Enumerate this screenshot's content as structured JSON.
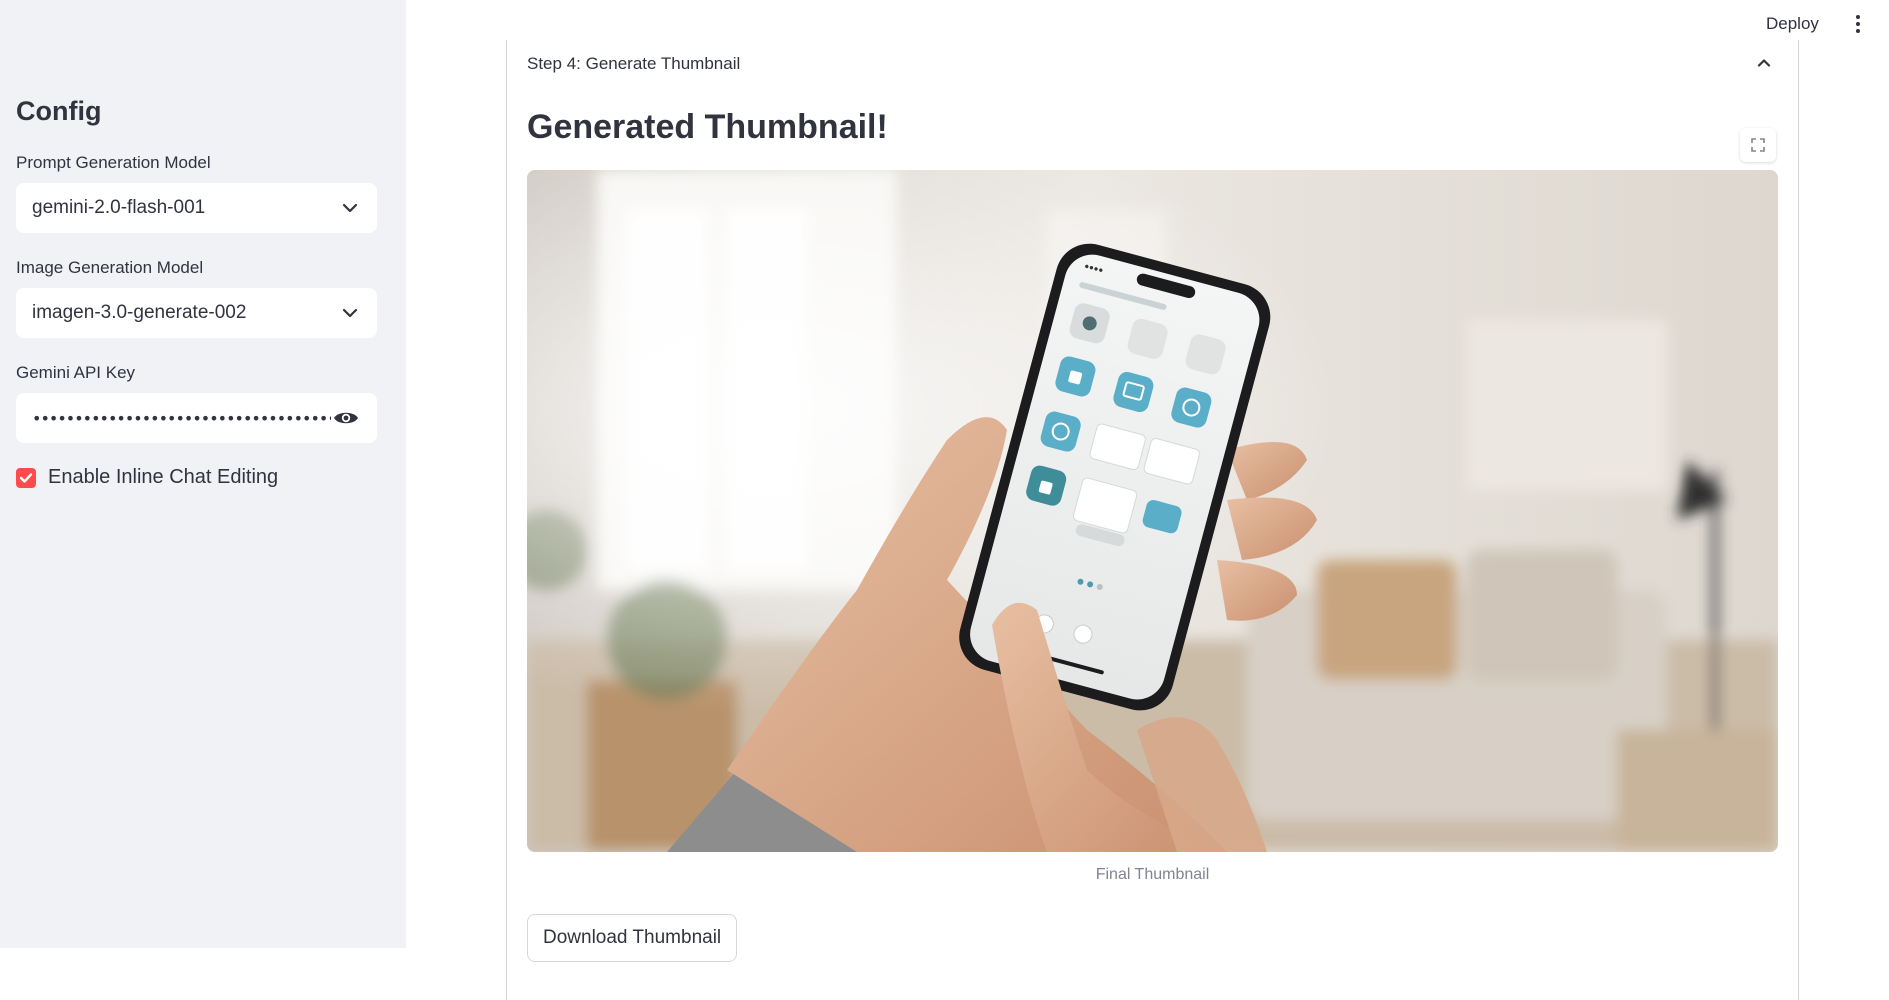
{
  "sidebar": {
    "title": "Config",
    "prompt_model": {
      "label": "Prompt Generation Model",
      "value": "gemini-2.0-flash-001"
    },
    "image_model": {
      "label": "Image Generation Model",
      "value": "imagen-3.0-generate-002"
    },
    "api_key": {
      "label": "Gemini API Key",
      "masked_value": "••••••••••••••••••••••••••••••••••••••"
    },
    "inline_chat": {
      "label": "Enable Inline Chat Editing",
      "checked": true
    }
  },
  "topbar": {
    "deploy_label": "Deploy"
  },
  "main": {
    "expander_title": "Step 4: Generate Thumbnail",
    "heading": "Generated Thumbnail!",
    "image_caption": "Final Thumbnail",
    "download_label": "Download Thumbnail"
  },
  "colors": {
    "accent": "#ff4b4b",
    "sidebar_bg": "#f0f2f6",
    "text": "#31333f",
    "muted": "#808495"
  }
}
